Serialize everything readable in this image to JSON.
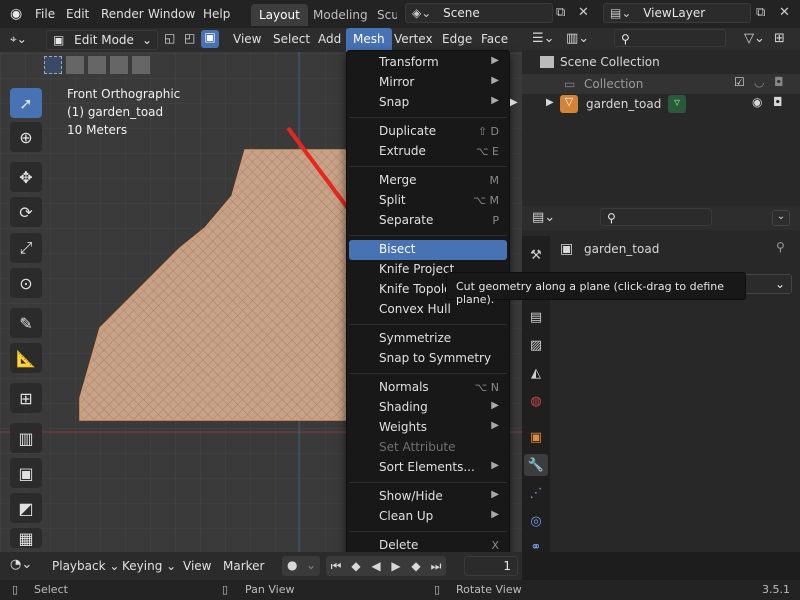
{
  "topbar": {
    "menus": [
      "File",
      "Edit",
      "Render",
      "Window",
      "Help"
    ],
    "workspace_tabs": [
      "Layout",
      "Modeling",
      "Scu"
    ],
    "scene": "Scene",
    "view_layer": "ViewLayer"
  },
  "viewport_header": {
    "mode": "Edit Mode",
    "menus": [
      "View",
      "Select",
      "Add",
      "Mesh",
      "Vertex",
      "Edge",
      "Face"
    ]
  },
  "viewport_overlay": {
    "view": "Front Orthographic",
    "object": "(1) garden_toad",
    "scale": "10 Meters"
  },
  "mesh_menu": [
    {
      "label": "Transform",
      "type": "submenu"
    },
    {
      "label": "Mirror",
      "type": "submenu"
    },
    {
      "label": "Snap",
      "type": "submenu"
    },
    {
      "label": "Duplicate",
      "shortcut": "⇧ D"
    },
    {
      "label": "Extrude",
      "shortcut": "⌥ E",
      "type": "submenu"
    },
    {
      "label": "Merge",
      "shortcut": "M",
      "type": "submenu"
    },
    {
      "label": "Split",
      "shortcut": "⌥ M",
      "type": "submenu"
    },
    {
      "label": "Separate",
      "shortcut": "P",
      "type": "submenu"
    },
    {
      "label": "Bisect",
      "selected": true
    },
    {
      "label": "Knife Project"
    },
    {
      "label": "Knife Topolog"
    },
    {
      "label": "Convex Hull"
    },
    {
      "label": "Symmetrize"
    },
    {
      "label": "Snap to Symmetry"
    },
    {
      "label": "Normals",
      "shortcut": "⌥ N",
      "type": "submenu"
    },
    {
      "label": "Shading",
      "type": "submenu"
    },
    {
      "label": "Weights",
      "type": "submenu"
    },
    {
      "label": "Set Attribute",
      "disabled": true
    },
    {
      "label": "Sort Elements...",
      "type": "submenu"
    },
    {
      "label": "Show/Hide",
      "type": "submenu"
    },
    {
      "label": "Clean Up",
      "type": "submenu"
    },
    {
      "label": "Delete",
      "shortcut": "X",
      "type": "submenu"
    }
  ],
  "tooltip": "Cut geometry along a plane (click-drag to define plane).",
  "outliner": {
    "root": "Scene Collection",
    "collection": "Collection",
    "object": "garden_toad"
  },
  "properties": {
    "object_name": "garden_toad"
  },
  "timeline": {
    "menus": [
      "Playback",
      "Keying",
      "View",
      "Marker"
    ],
    "frame": "1"
  },
  "statusbar": {
    "items": [
      "Select",
      "Pan View",
      "Rotate View"
    ],
    "version": "3.5.1"
  },
  "colors": {
    "accent": "#4772b3",
    "mesh_fill": "#c7a287",
    "arrow": "#e8261c"
  }
}
